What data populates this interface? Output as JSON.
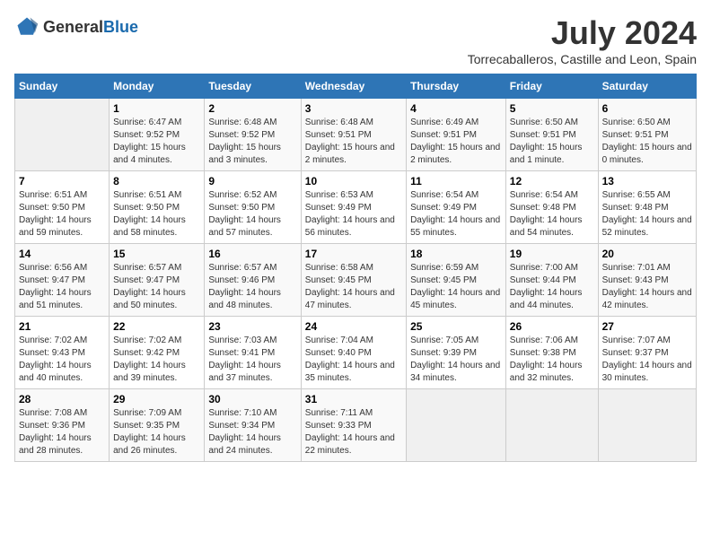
{
  "header": {
    "logo": {
      "text_general": "General",
      "text_blue": "Blue"
    },
    "title": "July 2024",
    "location": "Torrecaballeros, Castille and Leon, Spain"
  },
  "calendar": {
    "days_of_week": [
      "Sunday",
      "Monday",
      "Tuesday",
      "Wednesday",
      "Thursday",
      "Friday",
      "Saturday"
    ],
    "weeks": [
      [
        {
          "day": "",
          "empty": true
        },
        {
          "day": "1",
          "sunrise": "Sunrise: 6:47 AM",
          "sunset": "Sunset: 9:52 PM",
          "daylight": "Daylight: 15 hours and 4 minutes."
        },
        {
          "day": "2",
          "sunrise": "Sunrise: 6:48 AM",
          "sunset": "Sunset: 9:52 PM",
          "daylight": "Daylight: 15 hours and 3 minutes."
        },
        {
          "day": "3",
          "sunrise": "Sunrise: 6:48 AM",
          "sunset": "Sunset: 9:51 PM",
          "daylight": "Daylight: 15 hours and 2 minutes."
        },
        {
          "day": "4",
          "sunrise": "Sunrise: 6:49 AM",
          "sunset": "Sunset: 9:51 PM",
          "daylight": "Daylight: 15 hours and 2 minutes."
        },
        {
          "day": "5",
          "sunrise": "Sunrise: 6:50 AM",
          "sunset": "Sunset: 9:51 PM",
          "daylight": "Daylight: 15 hours and 1 minute."
        },
        {
          "day": "6",
          "sunrise": "Sunrise: 6:50 AM",
          "sunset": "Sunset: 9:51 PM",
          "daylight": "Daylight: 15 hours and 0 minutes."
        }
      ],
      [
        {
          "day": "7",
          "sunrise": "Sunrise: 6:51 AM",
          "sunset": "Sunset: 9:50 PM",
          "daylight": "Daylight: 14 hours and 59 minutes."
        },
        {
          "day": "8",
          "sunrise": "Sunrise: 6:51 AM",
          "sunset": "Sunset: 9:50 PM",
          "daylight": "Daylight: 14 hours and 58 minutes."
        },
        {
          "day": "9",
          "sunrise": "Sunrise: 6:52 AM",
          "sunset": "Sunset: 9:50 PM",
          "daylight": "Daylight: 14 hours and 57 minutes."
        },
        {
          "day": "10",
          "sunrise": "Sunrise: 6:53 AM",
          "sunset": "Sunset: 9:49 PM",
          "daylight": "Daylight: 14 hours and 56 minutes."
        },
        {
          "day": "11",
          "sunrise": "Sunrise: 6:54 AM",
          "sunset": "Sunset: 9:49 PM",
          "daylight": "Daylight: 14 hours and 55 minutes."
        },
        {
          "day": "12",
          "sunrise": "Sunrise: 6:54 AM",
          "sunset": "Sunset: 9:48 PM",
          "daylight": "Daylight: 14 hours and 54 minutes."
        },
        {
          "day": "13",
          "sunrise": "Sunrise: 6:55 AM",
          "sunset": "Sunset: 9:48 PM",
          "daylight": "Daylight: 14 hours and 52 minutes."
        }
      ],
      [
        {
          "day": "14",
          "sunrise": "Sunrise: 6:56 AM",
          "sunset": "Sunset: 9:47 PM",
          "daylight": "Daylight: 14 hours and 51 minutes."
        },
        {
          "day": "15",
          "sunrise": "Sunrise: 6:57 AM",
          "sunset": "Sunset: 9:47 PM",
          "daylight": "Daylight: 14 hours and 50 minutes."
        },
        {
          "day": "16",
          "sunrise": "Sunrise: 6:57 AM",
          "sunset": "Sunset: 9:46 PM",
          "daylight": "Daylight: 14 hours and 48 minutes."
        },
        {
          "day": "17",
          "sunrise": "Sunrise: 6:58 AM",
          "sunset": "Sunset: 9:45 PM",
          "daylight": "Daylight: 14 hours and 47 minutes."
        },
        {
          "day": "18",
          "sunrise": "Sunrise: 6:59 AM",
          "sunset": "Sunset: 9:45 PM",
          "daylight": "Daylight: 14 hours and 45 minutes."
        },
        {
          "day": "19",
          "sunrise": "Sunrise: 7:00 AM",
          "sunset": "Sunset: 9:44 PM",
          "daylight": "Daylight: 14 hours and 44 minutes."
        },
        {
          "day": "20",
          "sunrise": "Sunrise: 7:01 AM",
          "sunset": "Sunset: 9:43 PM",
          "daylight": "Daylight: 14 hours and 42 minutes."
        }
      ],
      [
        {
          "day": "21",
          "sunrise": "Sunrise: 7:02 AM",
          "sunset": "Sunset: 9:43 PM",
          "daylight": "Daylight: 14 hours and 40 minutes."
        },
        {
          "day": "22",
          "sunrise": "Sunrise: 7:02 AM",
          "sunset": "Sunset: 9:42 PM",
          "daylight": "Daylight: 14 hours and 39 minutes."
        },
        {
          "day": "23",
          "sunrise": "Sunrise: 7:03 AM",
          "sunset": "Sunset: 9:41 PM",
          "daylight": "Daylight: 14 hours and 37 minutes."
        },
        {
          "day": "24",
          "sunrise": "Sunrise: 7:04 AM",
          "sunset": "Sunset: 9:40 PM",
          "daylight": "Daylight: 14 hours and 35 minutes."
        },
        {
          "day": "25",
          "sunrise": "Sunrise: 7:05 AM",
          "sunset": "Sunset: 9:39 PM",
          "daylight": "Daylight: 14 hours and 34 minutes."
        },
        {
          "day": "26",
          "sunrise": "Sunrise: 7:06 AM",
          "sunset": "Sunset: 9:38 PM",
          "daylight": "Daylight: 14 hours and 32 minutes."
        },
        {
          "day": "27",
          "sunrise": "Sunrise: 7:07 AM",
          "sunset": "Sunset: 9:37 PM",
          "daylight": "Daylight: 14 hours and 30 minutes."
        }
      ],
      [
        {
          "day": "28",
          "sunrise": "Sunrise: 7:08 AM",
          "sunset": "Sunset: 9:36 PM",
          "daylight": "Daylight: 14 hours and 28 minutes."
        },
        {
          "day": "29",
          "sunrise": "Sunrise: 7:09 AM",
          "sunset": "Sunset: 9:35 PM",
          "daylight": "Daylight: 14 hours and 26 minutes."
        },
        {
          "day": "30",
          "sunrise": "Sunrise: 7:10 AM",
          "sunset": "Sunset: 9:34 PM",
          "daylight": "Daylight: 14 hours and 24 minutes."
        },
        {
          "day": "31",
          "sunrise": "Sunrise: 7:11 AM",
          "sunset": "Sunset: 9:33 PM",
          "daylight": "Daylight: 14 hours and 22 minutes."
        },
        {
          "day": "",
          "empty": true
        },
        {
          "day": "",
          "empty": true
        },
        {
          "day": "",
          "empty": true
        }
      ]
    ]
  }
}
